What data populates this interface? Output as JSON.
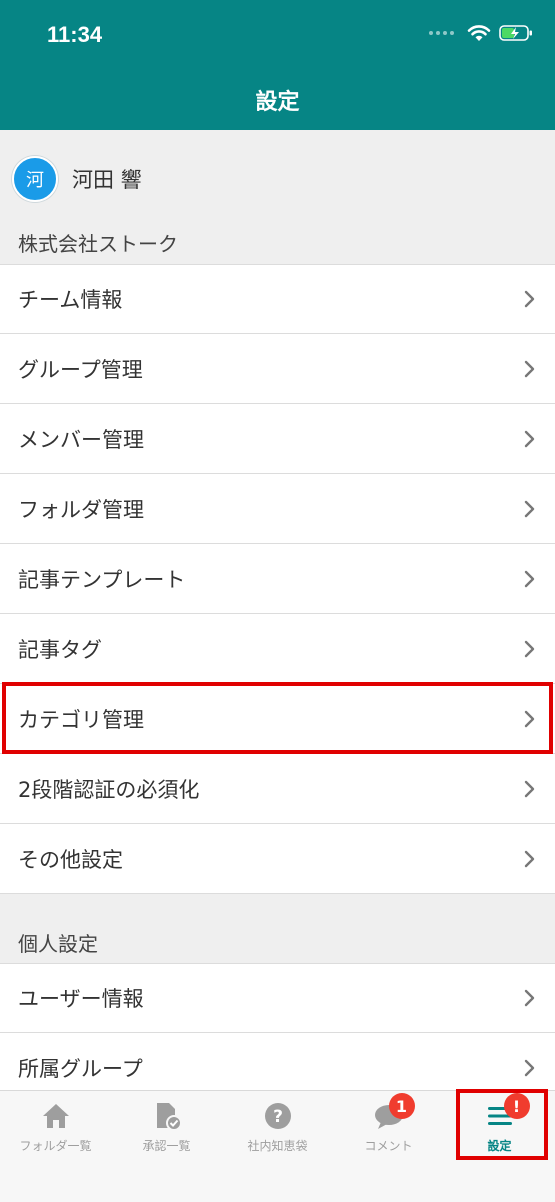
{
  "status_bar": {
    "time": "11:34"
  },
  "header": {
    "title": "設定"
  },
  "user": {
    "avatar_char": "河",
    "name": "河田 響"
  },
  "sections": {
    "company": "株式会社ストーク",
    "personal": "個人設定"
  },
  "company_items": [
    {
      "label": "チーム情報"
    },
    {
      "label": "グループ管理"
    },
    {
      "label": "メンバー管理"
    },
    {
      "label": "フォルダ管理"
    },
    {
      "label": "記事テンプレート"
    },
    {
      "label": "記事タグ"
    },
    {
      "label": "カテゴリ管理"
    },
    {
      "label": "2段階認証の必須化"
    },
    {
      "label": "その他設定"
    }
  ],
  "personal_items": [
    {
      "label": "ユーザー情報"
    },
    {
      "label": "所属グループ"
    }
  ],
  "tabs": [
    {
      "label": "フォルダ一覧",
      "icon": "home-icon"
    },
    {
      "label": "承認一覧",
      "icon": "document-check-icon"
    },
    {
      "label": "社内知恵袋",
      "icon": "question-icon"
    },
    {
      "label": "コメント",
      "icon": "chat-icon",
      "badge": "1"
    },
    {
      "label": "設定",
      "icon": "menu-icon",
      "badge": "!"
    }
  ],
  "colors": {
    "accent": "#068585",
    "avatar": "#1a9be8",
    "badge": "#f03c2e",
    "highlight": "#e00000"
  }
}
